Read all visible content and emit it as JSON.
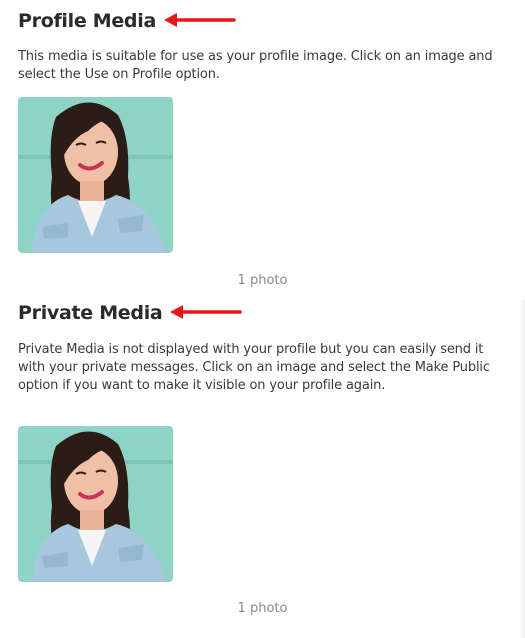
{
  "profile_media": {
    "title": "Profile Media",
    "description": "This media is suitable for use as your profile image. Click on an image and select the Use on Profile option.",
    "count": "1 photo"
  },
  "private_media": {
    "title": "Private Media",
    "description": "Private Media is not displayed with your profile but you can easily send it with your private messages. Click on an image and select the Make Public option if you want to make it visible on your profile again.",
    "count": "1 photo"
  },
  "colors": {
    "arrow": "#e8151b",
    "photo_background": "#8ed4c6",
    "count_text": "#8a8a8a"
  },
  "icons": [
    "red-arrow-icon"
  ]
}
